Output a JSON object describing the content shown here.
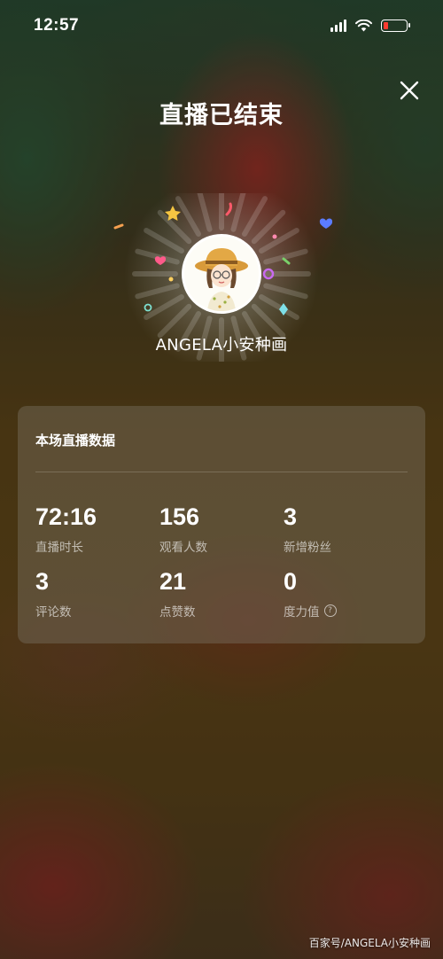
{
  "status_bar": {
    "time": "12:57"
  },
  "header": {
    "title": "直播已结束"
  },
  "profile": {
    "name": "ANGELA小安种画"
  },
  "stats": {
    "title": "本场直播数据",
    "items": [
      {
        "value": "72:16",
        "label": "直播时长"
      },
      {
        "value": "156",
        "label": "观看人数"
      },
      {
        "value": "3",
        "label": "新增粉丝"
      },
      {
        "value": "3",
        "label": "评论数"
      },
      {
        "value": "21",
        "label": "点赞数"
      },
      {
        "value": "0",
        "label": "度力值"
      }
    ],
    "help_glyph": "?"
  },
  "watermark": "百家号/ANGELA小安种画",
  "colors": {
    "battery_low": "#ff3b30",
    "star": "#f5c542",
    "heart_pink": "#ff5a8a",
    "heart_blue": "#5b7cff"
  }
}
